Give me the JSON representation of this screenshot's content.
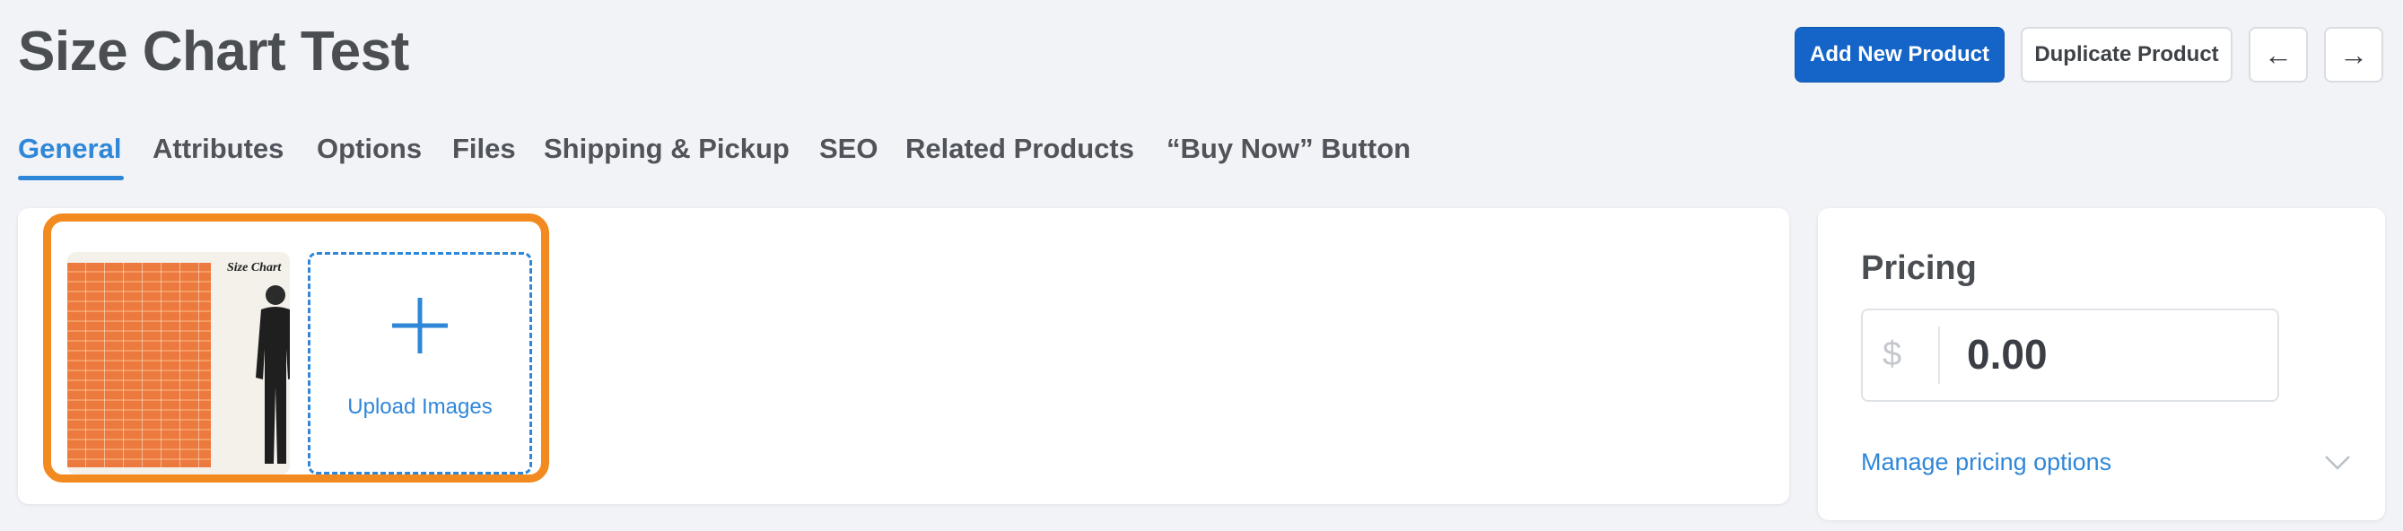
{
  "header": {
    "title": "Size Chart Test",
    "add_new_label": "Add New Product",
    "duplicate_label": "Duplicate Product",
    "prev_icon": "arrow-left-icon",
    "next_icon": "arrow-right-icon",
    "prev_glyph": "←",
    "next_glyph": "→"
  },
  "tabs": [
    {
      "label": "General",
      "active": true
    },
    {
      "label": "Attributes"
    },
    {
      "label": "Options"
    },
    {
      "label": "Files"
    },
    {
      "label": "Shipping & Pickup"
    },
    {
      "label": "SEO"
    },
    {
      "label": "Related Products"
    },
    {
      "label": "“Buy Now” Button"
    }
  ],
  "gallery": {
    "thumbnail_caption": "Size Chart",
    "upload_label": "Upload Images",
    "highlight_color": "#f28a20"
  },
  "pricing": {
    "title": "Pricing",
    "currency_symbol": "$",
    "price_value": "0.00",
    "manage_label": "Manage pricing options"
  },
  "colors": {
    "accent": "#2f87d8",
    "primary_button": "#1565c9"
  }
}
